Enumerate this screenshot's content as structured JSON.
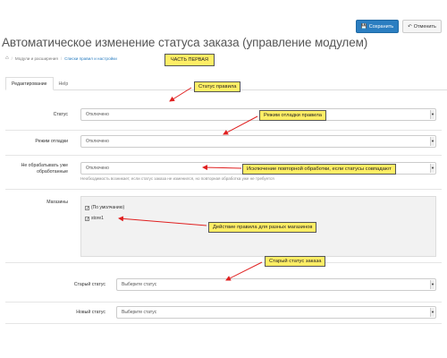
{
  "toolbar": {
    "save_label": "Сохранить",
    "cancel_label": "Отменить"
  },
  "page": {
    "title": "Автоматическое изменение статуса заказа (управление модулем)"
  },
  "breadcrumb": {
    "items": [
      "Модули и расширения",
      "Списки правил и настройки"
    ]
  },
  "banner": "ЧАСТЬ ПЕРВАЯ",
  "tabs": [
    "Редактирование",
    "Help"
  ],
  "form": {
    "status": {
      "label": "Статус",
      "value": "Отключено"
    },
    "debug": {
      "label": "Режим отладки",
      "value": "Отключено"
    },
    "skip": {
      "label_line1": "Не обрабатывать уже",
      "label_line2": "обработанные",
      "value": "Отключено",
      "help": "Необходимость возникает, если статус заказа не изменился, но повторная обработка уже не требуется"
    },
    "stores": {
      "label": "Магазины",
      "default_option": "(По умолчанию)",
      "store_option": "store1"
    },
    "old_status": {
      "label": "Старый статус",
      "placeholder": "Выберите статус"
    },
    "new_status": {
      "label": "Новый статус",
      "placeholder": "Выберите статус"
    }
  },
  "callouts": {
    "rule_status": "Статус правила",
    "debug_mode": "Режим отладки правила",
    "repeat": "Исключение повторной обработки, если статусы совпадают",
    "multi_store": "Действие правила для разных магазинов",
    "old_status": "Старый статус заказа"
  },
  "colors": {
    "primary": "#2b7ec1",
    "callout": "#ffee66",
    "arrow": "#e02020"
  }
}
